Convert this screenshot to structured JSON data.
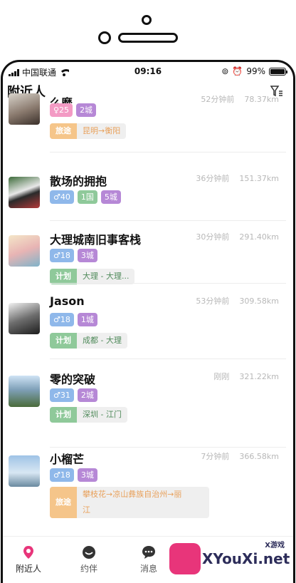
{
  "status_bar": {
    "carrier": "中国联通",
    "time": "09:16",
    "battery": "99%",
    "battery_level": 0.99
  },
  "header": {
    "title": "附近人"
  },
  "colors": {
    "pink": "#f39ac4",
    "blue": "#8fb8ea",
    "purple": "#b688d6",
    "green": "#8fc99a",
    "orange": "#f5c58a",
    "route_orange": "#e8a05a",
    "route_green": "#4f8a5a"
  },
  "users": [
    {
      "name": "么麼",
      "time": "52分钟前",
      "distance": "78.37km",
      "tags": [
        {
          "text": "♀25",
          "color": "#f39ac4"
        },
        {
          "text": "2城",
          "color": "#b688d6"
        }
      ],
      "plan": {
        "label": "旅途",
        "route": "昆明→衡阳",
        "kind": "trip"
      }
    },
    {
      "name": "散场的拥抱",
      "time": "36分钟前",
      "distance": "151.37km",
      "tags": [
        {
          "text": "♂40",
          "color": "#8fb8ea"
        },
        {
          "text": "1国",
          "color": "#8fc99a"
        },
        {
          "text": "5城",
          "color": "#b688d6"
        }
      ],
      "plan": null
    },
    {
      "name": "大理城南旧事客栈",
      "time": "30分钟前",
      "distance": "291.40km",
      "tags": [
        {
          "text": "♂18",
          "color": "#8fb8ea"
        },
        {
          "text": "3城",
          "color": "#b688d6"
        }
      ],
      "plan": {
        "label": "计划",
        "route": "大理 - 大理...",
        "kind": "plan"
      }
    },
    {
      "name": "Jason",
      "time": "53分钟前",
      "distance": "309.58km",
      "tags": [
        {
          "text": "♂18",
          "color": "#8fb8ea"
        },
        {
          "text": "1城",
          "color": "#b688d6"
        }
      ],
      "plan": {
        "label": "计划",
        "route": "成都 - 大理",
        "kind": "plan"
      }
    },
    {
      "name": "零的突破",
      "time": "刚刚",
      "distance": "321.22km",
      "tags": [
        {
          "text": "♂31",
          "color": "#8fb8ea"
        },
        {
          "text": "2城",
          "color": "#b688d6"
        }
      ],
      "plan": {
        "label": "计划",
        "route": "深圳 - 江门",
        "kind": "plan"
      }
    },
    {
      "name": "小榴芒",
      "time": "7分钟前",
      "distance": "366.58km",
      "tags": [
        {
          "text": "♂18",
          "color": "#8fb8ea"
        },
        {
          "text": "3城",
          "color": "#b688d6"
        }
      ],
      "plan": {
        "label": "旅途",
        "route": "攀枝花→凉山彝族自治州→丽",
        "route2": "江",
        "kind": "trip"
      }
    }
  ],
  "tabbar": {
    "tabs": [
      {
        "label": "附近人",
        "icon": "location-pin-icon",
        "active": true
      },
      {
        "label": "约伴",
        "icon": "smile-icon",
        "active": false
      },
      {
        "label": "消息",
        "icon": "chat-bubble-icon",
        "active": false
      }
    ]
  },
  "watermark": {
    "text": "XYouXi.net",
    "small": "X游戏"
  }
}
